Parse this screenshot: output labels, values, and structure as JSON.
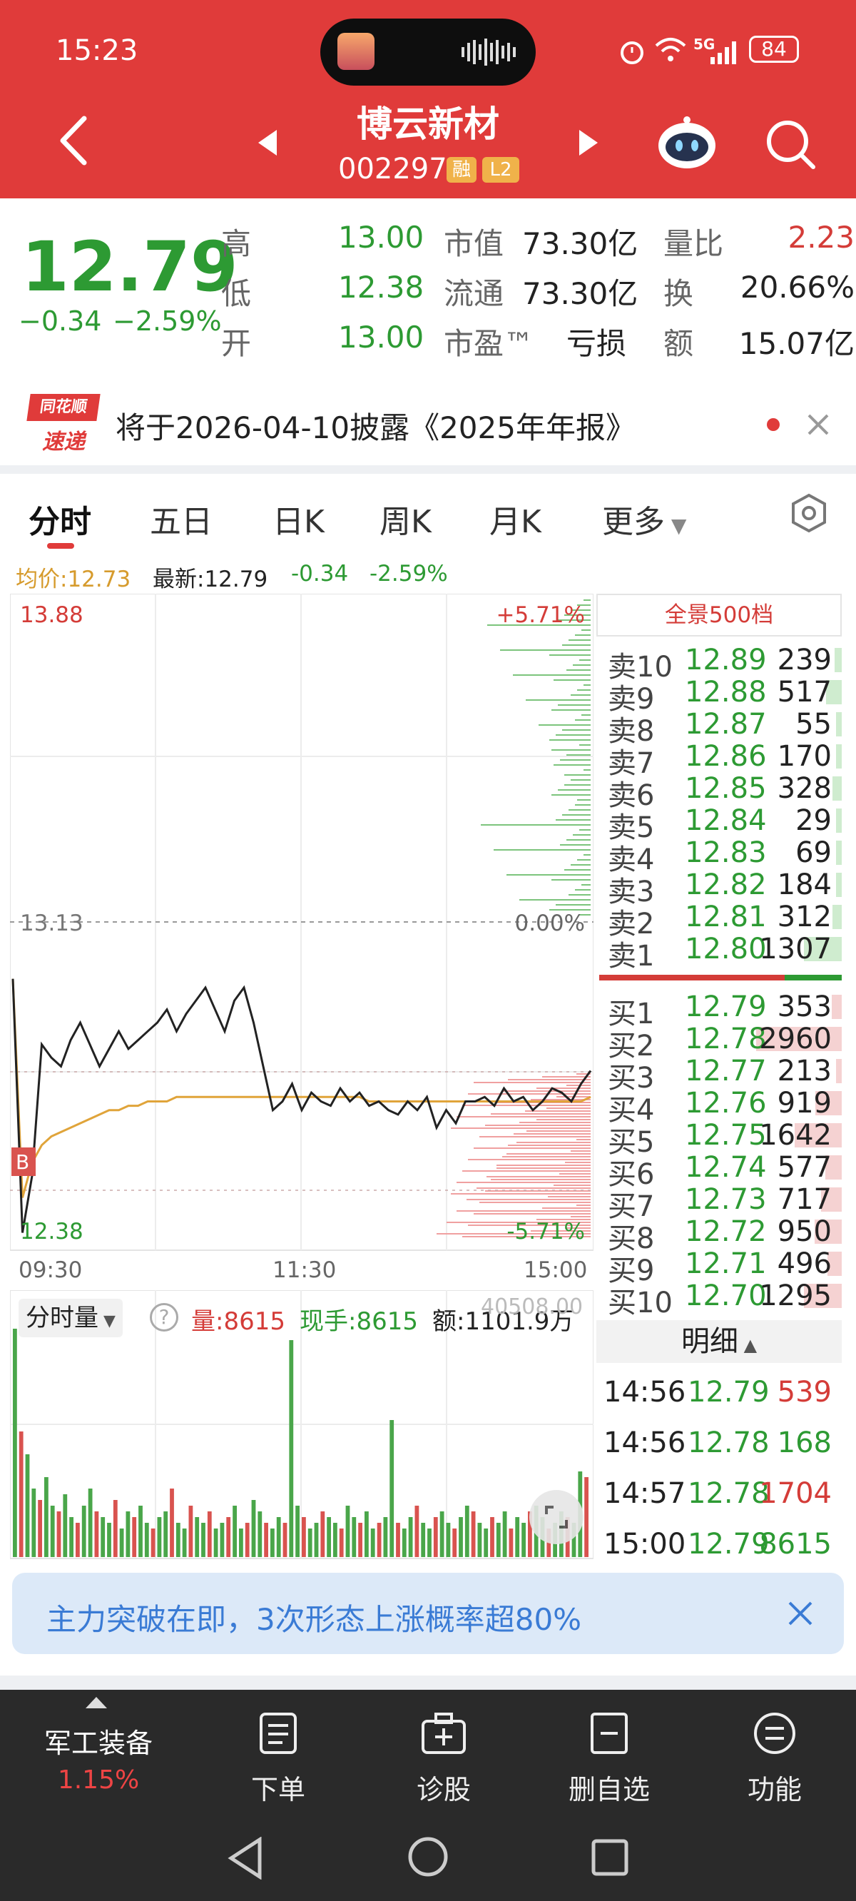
{
  "status_bar": {
    "time": "15:23",
    "battery": "84",
    "network": "5G"
  },
  "header": {
    "stock_name": "博云新材",
    "stock_code": "002297",
    "badge_rong": "融",
    "badge_l2": "L2"
  },
  "quote": {
    "price": "12.79",
    "change": "−0.34",
    "change_pct": "−2.59%",
    "high_label": "高",
    "high": "13.00",
    "low_label": "低",
    "low": "12.38",
    "open_label": "开",
    "open": "13.00",
    "mktcap_label": "市值",
    "mktcap": "73.30亿",
    "float_label": "流通",
    "float": "73.30亿",
    "pe_label": "市盈™",
    "pe": "亏损",
    "vol_ratio_label": "量比",
    "vol_ratio": "2.23",
    "turnover_label": "换",
    "turnover": "20.66%",
    "amount_label": "额",
    "amount": "15.07亿"
  },
  "announcement": {
    "logo_top": "同花顺",
    "logo_bottom": "速递",
    "text": "将于2026-04-10披露《2025年年报》"
  },
  "tabs": [
    "分时",
    "五日",
    "日K",
    "周K",
    "月K",
    "更多"
  ],
  "active_tab": 0,
  "info_line": {
    "avg_label": "均价:12.73",
    "latest_label": "最新:12.79",
    "change": "-0.34",
    "change_pct": "-2.59%"
  },
  "chart_data": {
    "type": "line",
    "title": "",
    "x_ticks": [
      "09:30",
      "11:30",
      "15:00"
    ],
    "y_max_label": "13.88",
    "y_mid_label": "13.13",
    "y_min_label": "12.38",
    "pct_max_label": "+5.71%",
    "pct_mid_label": "0.00%",
    "pct_min_label": "-5.71%",
    "ylim": [
      12.38,
      13.88
    ],
    "prev_close": 13.13,
    "buy_marker": "B",
    "series": [
      {
        "name": "最新",
        "color": "#222222",
        "values": [
          13.0,
          12.42,
          12.55,
          12.85,
          12.82,
          12.8,
          12.86,
          12.9,
          12.85,
          12.8,
          12.84,
          12.88,
          12.84,
          12.86,
          12.88,
          12.9,
          12.93,
          12.88,
          12.92,
          12.95,
          12.98,
          12.93,
          12.88,
          12.95,
          12.98,
          12.9,
          12.8,
          12.7,
          12.72,
          12.76,
          12.7,
          12.74,
          12.72,
          12.71,
          12.75,
          12.72,
          12.74,
          12.71,
          12.72,
          12.7,
          12.69,
          12.72,
          12.7,
          12.73,
          12.66,
          12.7,
          12.67,
          12.72,
          12.72,
          12.73,
          12.71,
          12.75,
          12.72,
          12.73,
          12.7,
          12.72,
          12.75,
          12.74,
          12.72,
          12.76,
          12.79
        ]
      },
      {
        "name": "均价",
        "color": "#e0a43a",
        "values": [
          13.0,
          12.5,
          12.58,
          12.62,
          12.64,
          12.65,
          12.66,
          12.67,
          12.68,
          12.69,
          12.7,
          12.7,
          12.71,
          12.71,
          12.72,
          12.72,
          12.72,
          12.73,
          12.73,
          12.73,
          12.73,
          12.73,
          12.73,
          12.73,
          12.73,
          12.73,
          12.73,
          12.73,
          12.73,
          12.73,
          12.73,
          12.73,
          12.73,
          12.73,
          12.73,
          12.73,
          12.73,
          12.72,
          12.72,
          12.72,
          12.72,
          12.72,
          12.72,
          12.72,
          12.72,
          12.72,
          12.72,
          12.72,
          12.72,
          12.72,
          12.72,
          12.72,
          12.72,
          12.72,
          12.72,
          12.72,
          12.72,
          12.72,
          12.72,
          12.72,
          12.73
        ]
      }
    ]
  },
  "volume": {
    "selector_label": "分时量",
    "volume_label": "量:8615",
    "current_hand_label": "现手:8615",
    "amount_label": "额:1101.9万",
    "max_label": "40508.00",
    "bars": [
      40,
      22,
      18,
      12,
      10,
      14,
      9,
      8,
      11,
      7,
      6,
      9,
      12,
      8,
      7,
      6,
      10,
      5,
      8,
      7,
      9,
      6,
      5,
      7,
      8,
      12,
      6,
      5,
      9,
      7,
      6,
      8,
      5,
      6,
      7,
      9,
      5,
      6,
      10,
      8,
      6,
      5,
      7,
      6,
      38,
      9,
      7,
      5,
      6,
      8,
      7,
      6,
      5,
      9,
      7,
      6,
      8,
      5,
      6,
      7,
      24,
      6,
      5,
      7,
      9,
      6,
      5,
      7,
      8,
      6,
      5,
      7,
      9,
      8,
      6,
      5,
      7,
      6,
      8,
      5,
      7,
      6,
      8,
      9,
      7,
      5,
      6,
      8,
      7,
      6,
      15,
      14
    ]
  },
  "orderbook": {
    "title": "全景500档",
    "asks": [
      {
        "label": "卖10",
        "price": "12.89",
        "vol": "239",
        "bar": 0.08
      },
      {
        "label": "卖9",
        "price": "12.88",
        "vol": "517",
        "bar": 0.18
      },
      {
        "label": "卖8",
        "price": "12.87",
        "vol": "55",
        "bar": 0.02
      },
      {
        "label": "卖7",
        "price": "12.86",
        "vol": "170",
        "bar": 0.06
      },
      {
        "label": "卖6",
        "price": "12.85",
        "vol": "328",
        "bar": 0.11
      },
      {
        "label": "卖5",
        "price": "12.84",
        "vol": "29",
        "bar": 0.01
      },
      {
        "label": "卖4",
        "price": "12.83",
        "vol": "69",
        "bar": 0.02
      },
      {
        "label": "卖3",
        "price": "12.82",
        "vol": "184",
        "bar": 0.06
      },
      {
        "label": "卖2",
        "price": "12.81",
        "vol": "312",
        "bar": 0.11
      },
      {
        "label": "卖1",
        "price": "12.80",
        "vol": "1307",
        "bar": 0.44
      }
    ],
    "bids": [
      {
        "label": "买1",
        "price": "12.79",
        "vol": "353",
        "bar": 0.12
      },
      {
        "label": "买2",
        "price": "12.78",
        "vol": "2960",
        "bar": 1.0
      },
      {
        "label": "买3",
        "price": "12.77",
        "vol": "213",
        "bar": 0.07
      },
      {
        "label": "买4",
        "price": "12.76",
        "vol": "919",
        "bar": 0.31
      },
      {
        "label": "买5",
        "price": "12.75",
        "vol": "1642",
        "bar": 0.55
      },
      {
        "label": "买6",
        "price": "12.74",
        "vol": "577",
        "bar": 0.19
      },
      {
        "label": "买7",
        "price": "12.73",
        "vol": "717",
        "bar": 0.24
      },
      {
        "label": "买8",
        "price": "12.72",
        "vol": "950",
        "bar": 0.32
      },
      {
        "label": "买9",
        "price": "12.71",
        "vol": "496",
        "bar": 0.17
      },
      {
        "label": "买10",
        "price": "12.70",
        "vol": "1295",
        "bar": 0.44
      }
    ]
  },
  "detail": {
    "title": "明细",
    "rows": [
      {
        "time": "14:56",
        "price": "12.79",
        "vol": "539",
        "dir": "red"
      },
      {
        "time": "14:56",
        "price": "12.78",
        "vol": "168",
        "dir": "green"
      },
      {
        "time": "14:57",
        "price": "12.78",
        "vol": "1704",
        "dir": "red"
      },
      {
        "time": "15:00",
        "price": "12.79",
        "vol": "8615",
        "dir": "green"
      }
    ]
  },
  "banner": {
    "text": "主力突破在即，3次形态上涨概率超80%"
  },
  "bottom_nav": {
    "sector_name": "军工装备",
    "sector_pct": "1.15%",
    "items": [
      {
        "label": "下单",
        "icon": "order-doc-icon"
      },
      {
        "label": "诊股",
        "icon": "diagnose-icon"
      },
      {
        "label": "删自选",
        "icon": "remove-watchlist-icon"
      },
      {
        "label": "功能",
        "icon": "menu-icon"
      }
    ]
  },
  "colors": {
    "red": "#e03b3a",
    "green": "#2d9a33",
    "avg_line": "#e0a43a",
    "banner_text": "#3a7bd5"
  }
}
